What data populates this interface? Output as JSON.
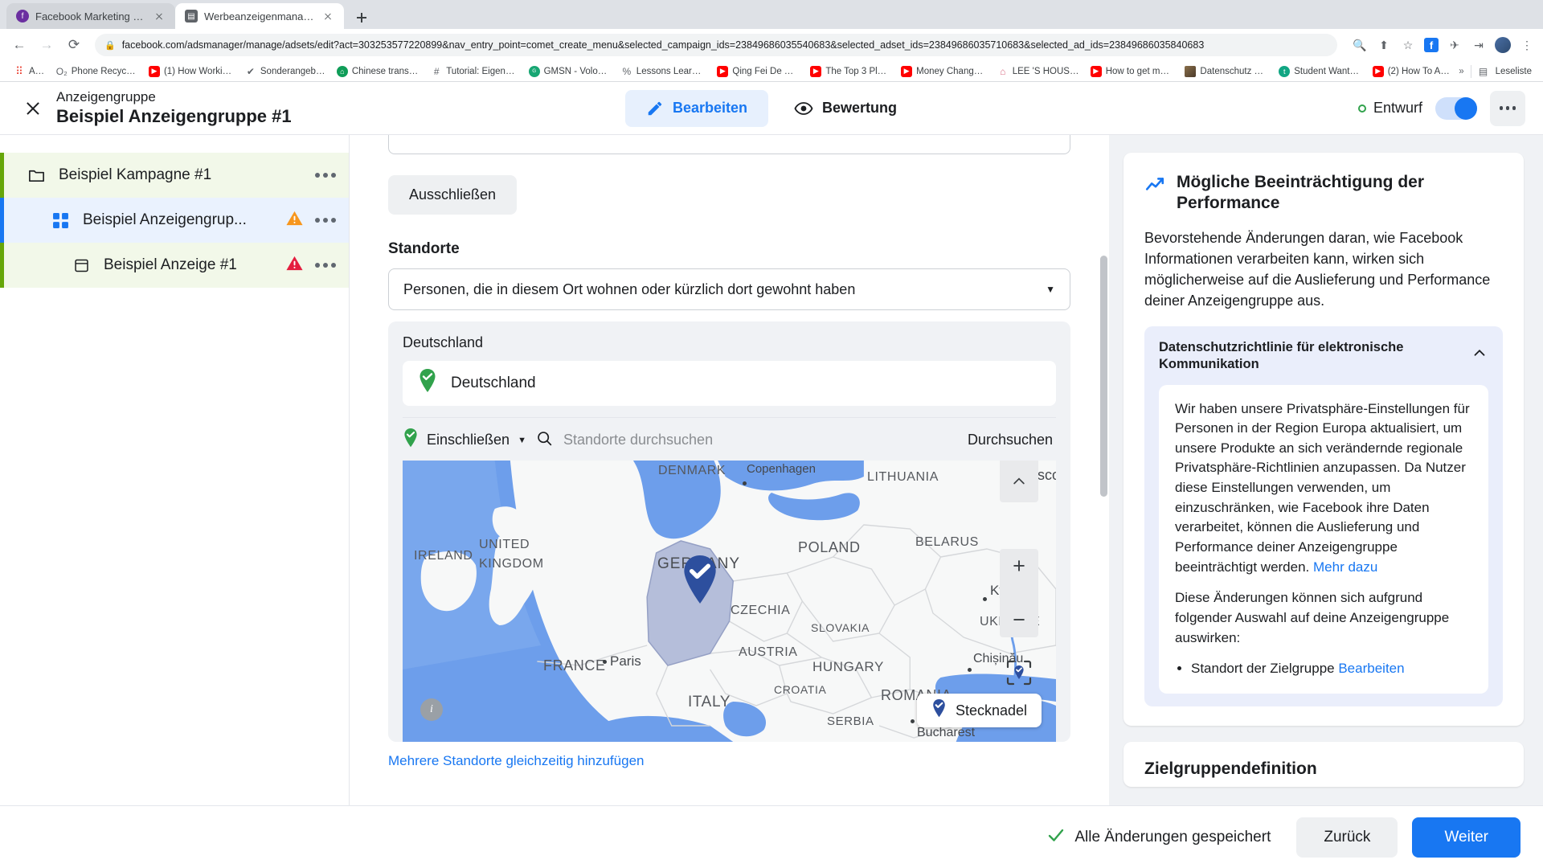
{
  "browser": {
    "tabs": [
      {
        "title": "Facebook Marketing & Werbea",
        "favicon": "facebook-favicon",
        "active": false
      },
      {
        "title": "Werbeanzeigenmanager - Wer",
        "favicon": "document-favicon",
        "active": true
      }
    ],
    "new_tab_label": "+",
    "url": "facebook.com/adsmanager/manage/adsets/edit?act=303253577220899&nav_entry_point=comet_create_menu&selected_campaign_ids=23849686035540683&selected_adset_ids=23849686035710683&selected_ad_ids=23849686035840683",
    "nav": {
      "back": "←",
      "forward": "→",
      "reload": "⟳"
    },
    "bookmarks": [
      {
        "label": "Apps",
        "icon": "apps-grid-icon"
      },
      {
        "label": "Phone Recycling,...",
        "icon": "o2-icon"
      },
      {
        "label": "(1) How Working a...",
        "icon": "youtube-icon"
      },
      {
        "label": "Sonderangebot! |...",
        "icon": "check-circle-icon"
      },
      {
        "label": "Chinese translatio...",
        "icon": "green-circle-icon"
      },
      {
        "label": "Tutorial: Eigene Fa...",
        "icon": "hash-icon"
      },
      {
        "label": "GMSN - Vologda,...",
        "icon": "gmsn-icon"
      },
      {
        "label": "Lessons Learned f...",
        "icon": "percent-icon"
      },
      {
        "label": "Qing Fei De Yi - Y...",
        "icon": "youtube-icon"
      },
      {
        "label": "The Top 3 Platfor...",
        "icon": "youtube-icon"
      },
      {
        "label": "Money Changes E...",
        "icon": "youtube-icon"
      },
      {
        "label": "LEE 'S HOUSE—...",
        "icon": "house-icon"
      },
      {
        "label": "How to get more v...",
        "icon": "youtube-icon"
      },
      {
        "label": "Datenschutz – Re...",
        "icon": "image-icon"
      },
      {
        "label": "Student Wants an...",
        "icon": "t-circle-icon"
      },
      {
        "label": "(2) How To Add A...",
        "icon": "youtube-icon"
      }
    ],
    "bookmarks_overflow": "»",
    "reading_list_label": "Leseliste"
  },
  "header": {
    "close_label": "close-icon",
    "eyebrow": "Anzeigengruppe",
    "title": "Beispiel Anzeigengruppe #1",
    "tabs": [
      {
        "label": "Bearbeiten",
        "icon": "pencil-icon",
        "active": true
      },
      {
        "label": "Bewertung",
        "icon": "eye-icon",
        "active": false
      }
    ],
    "status": "Entwurf",
    "status_color": "#31a24c",
    "toggle_on": true,
    "more_label": "more-options"
  },
  "sidebar": {
    "items": [
      {
        "label": "Beispiel Kampagne #1",
        "icon": "folder-icon",
        "level": 0,
        "warning": "none",
        "accent": "#66a60a"
      },
      {
        "label": "Beispiel Anzeigengrup...",
        "icon": "adset-grid-icon",
        "level": 1,
        "warning": "orange",
        "accent": "#1877f2"
      },
      {
        "label": "Beispiel Anzeige #1",
        "icon": "ad-icon",
        "level": 2,
        "warning": "red",
        "accent": "#66a60a"
      }
    ],
    "row_menu_label": "row-options"
  },
  "main": {
    "exclude_button": "Ausschließen",
    "locations_heading": "Standorte",
    "location_type_value": "Personen, die in diesem Ort wohnen oder kürzlich dort gewohnt haben",
    "selected_group_label": "Deutschland",
    "selected_location": "Deutschland",
    "include_label": "Einschließen",
    "search_placeholder": "Standorte durchsuchen",
    "search_button": "Durchsuchen",
    "bulk_add_link": "Mehrere Standorte gleichzeitig hinzufügen",
    "map": {
      "pin_badge": "Stecknadel",
      "zoom_in": "+",
      "zoom_out": "−",
      "collapse": "^",
      "info": "i",
      "locate": "locate-icon",
      "countries": [
        "IRELAND",
        "UNITED",
        "KINGDOM",
        "DENMARK",
        "GERMANY",
        "POLAND",
        "LITHUANIA",
        "BELARUS",
        "CZECHIA",
        "SLOVAKIA",
        "FRANCE",
        "AUSTRIA",
        "HUNGARY",
        "ROMANIA",
        "ITALY",
        "CROATIA",
        "SERBIA",
        "UKRAINE"
      ],
      "cities": [
        "Copenhagen",
        "Moscow",
        "Paris",
        "Kyiv",
        "Chișinău",
        "Bucharest"
      ]
    }
  },
  "right_panel": {
    "card_title": "Mögliche Beeinträchtigung der Performance",
    "card_icon": "trending-chart-icon",
    "card_body": "Bevorstehende Änderungen daran, wie Facebook Informationen verarbeiten kann, wirken sich möglicherweise auf die Auslieferung und Performance deiner Anzeigengruppe aus.",
    "policy_title": "Datenschutzrichtlinie für elektronische Kommunikation",
    "policy_collapse_icon": "chevron-up-icon",
    "policy_p1": "Wir haben unsere Privatsphäre-Einstellungen für Personen in der Region Europa aktualisiert, um unsere Produkte an sich verändernde regionale Privatsphäre-Richtlinien anzupassen. Da Nutzer diese Einstellungen verwenden, um einzuschränken, wie Facebook ihre Daten verarbeitet, können die Auslieferung und Performance deiner Anzeigengruppe beeinträchtigt werden.",
    "policy_p1_link": "Mehr dazu",
    "policy_p2": "Diese Änderungen können sich aufgrund folgender Auswahl auf deine Anzeigengruppe auswirken:",
    "policy_bullet": "Standort der Zielgruppe",
    "policy_bullet_link": "Bearbeiten",
    "second_card_title": "Zielgruppendefinition"
  },
  "footer": {
    "saved_text": "Alle Änderungen gespeichert",
    "saved_icon": "check-icon",
    "back_button": "Zurück",
    "next_button": "Weiter"
  },
  "colors": {
    "accent_blue": "#1877f2",
    "green": "#31a24c",
    "warning_orange": "#f7961d",
    "warning_red": "#e41e3f"
  }
}
